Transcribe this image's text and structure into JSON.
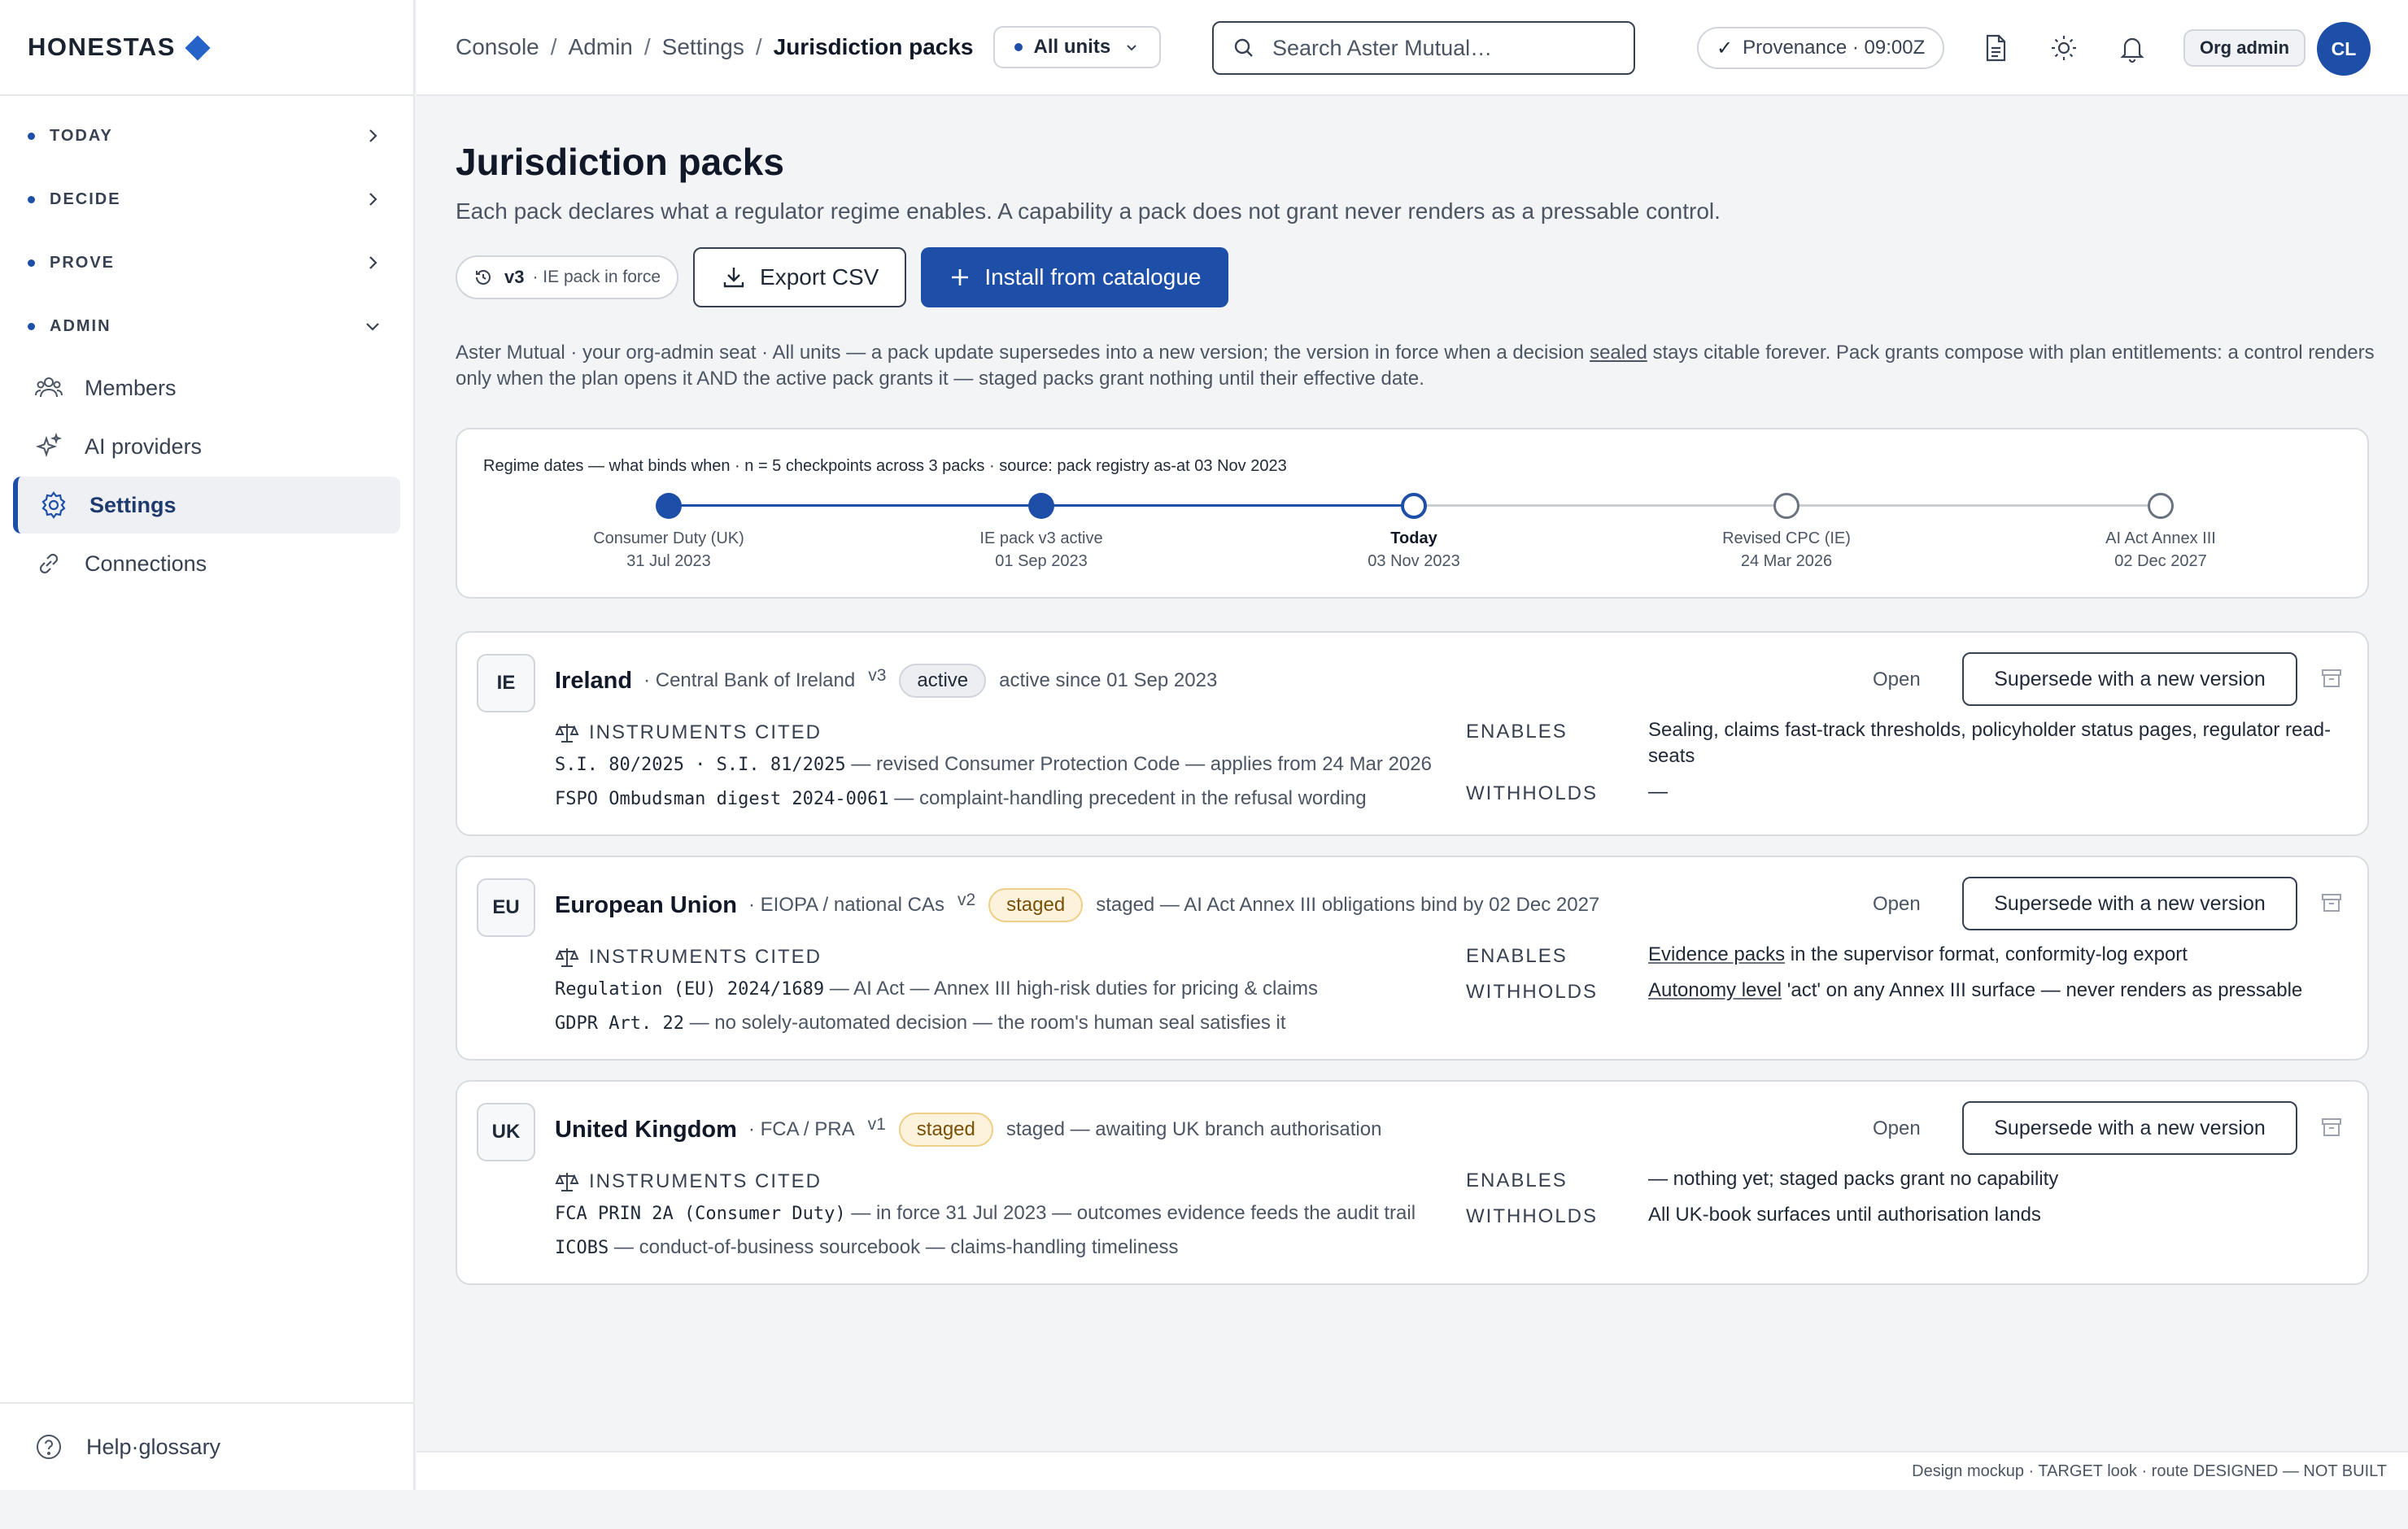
{
  "brand": {
    "name": "HONESTAS"
  },
  "sidebar": {
    "groups": [
      {
        "label": "TODAY"
      },
      {
        "label": "DECIDE"
      },
      {
        "label": "PROVE"
      },
      {
        "label": "ADMIN"
      }
    ],
    "items": [
      {
        "label": "Members",
        "icon": "users-icon"
      },
      {
        "label": "AI providers",
        "icon": "sparkle-icon"
      },
      {
        "label": "Settings",
        "icon": "gear-icon"
      },
      {
        "label": "Connections",
        "icon": "link-icon"
      }
    ],
    "help": "Help·glossary"
  },
  "topbar": {
    "breadcrumb": [
      "Console",
      "Admin",
      "Settings",
      "Jurisdiction packs"
    ],
    "units": "All units",
    "search_placeholder": "Search Aster Mutual…",
    "provenance": "Provenance · 09:00Z",
    "role": "Org admin",
    "avatar": "CL"
  },
  "page": {
    "title": "Jurisdiction packs",
    "subtitle": "Each pack declares what a regulator regime enables. A capability a pack does not grant never renders as a pressable control.",
    "version_pill": {
      "version": "v3",
      "text": "· IE pack in force"
    },
    "export_label": "Export CSV",
    "install_label": "Install from catalogue",
    "note_pre": "Aster Mutual · your org-admin seat · All units — a pack update supersedes into a new version; the version in force when a decision",
    "note_term": "sealed",
    "note_post": "stays citable forever. Pack grants compose with plan entitlements: a control renders only when the plan opens it AND the active pack grants it — staged packs grant nothing until their effective date."
  },
  "timeline": {
    "title": "Regime dates — what binds when · n = 5 checkpoints across 3 packs · source: pack registry as-at 03 Nov 2023",
    "points": [
      {
        "name": "Consumer Duty (UK)",
        "date": "31 Jul 2023",
        "state": "past"
      },
      {
        "name": "IE pack v3 active",
        "date": "01 Sep 2023",
        "state": "past"
      },
      {
        "name": "Today",
        "date": "03 Nov 2023",
        "state": "today"
      },
      {
        "name": "Revised CPC (IE)",
        "date": "24 Mar 2026",
        "state": "future"
      },
      {
        "name": "AI Act Annex III",
        "date": "02 Dec 2027",
        "state": "future"
      }
    ]
  },
  "packs": [
    {
      "code": "IE",
      "name": "Ireland",
      "regulator": "· Central Bank of Ireland",
      "version": "v3",
      "status": "active",
      "status_note": "active since 01 Sep 2023",
      "open_label": "Open",
      "supersede_label": "Supersede with a new version",
      "instruments_label": "INSTRUMENTS CITED",
      "instruments": [
        {
          "ref": "S.I. 80/2025 · S.I. 81/2025",
          "desc": " — revised Consumer Protection Code — applies from 24 Mar 2026"
        },
        {
          "ref": "FSPO Ombudsman digest 2024-0061",
          "desc": " — complaint-handling precedent in the refusal wording"
        }
      ],
      "enables_label": "ENABLES",
      "enables_term": "",
      "enables": "Sealing, claims fast-track thresholds, policyholder status pages, regulator read-seats",
      "withholds_label": "WITHHOLDS",
      "withholds_term": "",
      "withholds": "—"
    },
    {
      "code": "EU",
      "name": "European Union",
      "regulator": "· EIOPA / national CAs",
      "version": "v2",
      "status": "staged",
      "status_note": "staged — AI Act Annex III obligations bind by 02 Dec 2027",
      "open_label": "Open",
      "supersede_label": "Supersede with a new version",
      "instruments_label": "INSTRUMENTS CITED",
      "instruments": [
        {
          "ref": "Regulation (EU) 2024/1689",
          "desc": " — AI Act — Annex III high-risk duties for pricing & claims"
        },
        {
          "ref": "GDPR Art. 22",
          "desc": " — no solely-automated decision — the room's human seal satisfies it"
        }
      ],
      "enables_label": "ENABLES",
      "enables_term": "Evidence packs",
      "enables": " in the supervisor format, conformity-log export",
      "withholds_label": "WITHHOLDS",
      "withholds_term": "Autonomy level",
      "withholds": " 'act' on any Annex III surface — never renders as pressable"
    },
    {
      "code": "UK",
      "name": "United Kingdom",
      "regulator": "· FCA / PRA",
      "version": "v1",
      "status": "staged",
      "status_note": "staged — awaiting UK branch authorisation",
      "open_label": "Open",
      "supersede_label": "Supersede with a new version",
      "instruments_label": "INSTRUMENTS CITED",
      "instruments": [
        {
          "ref": "FCA PRIN 2A (Consumer Duty)",
          "desc": " — in force 31 Jul 2023 — outcomes evidence feeds the audit trail"
        },
        {
          "ref": "ICOBS",
          "desc": " — conduct-of-business sourcebook — claims-handling timeliness"
        }
      ],
      "enables_label": "ENABLES",
      "enables_term": "",
      "enables": "— nothing yet; staged packs grant no capability",
      "withholds_label": "WITHHOLDS",
      "withholds_term": "",
      "withholds": "All UK-book surfaces until authorisation lands"
    }
  ],
  "footer": "Design mockup · TARGET look · route DESIGNED — NOT BUILT",
  "colors": {
    "accent": "#1e4fa8",
    "staged_bg": "#fdf3dd",
    "staged_text": "#7a4f08"
  }
}
